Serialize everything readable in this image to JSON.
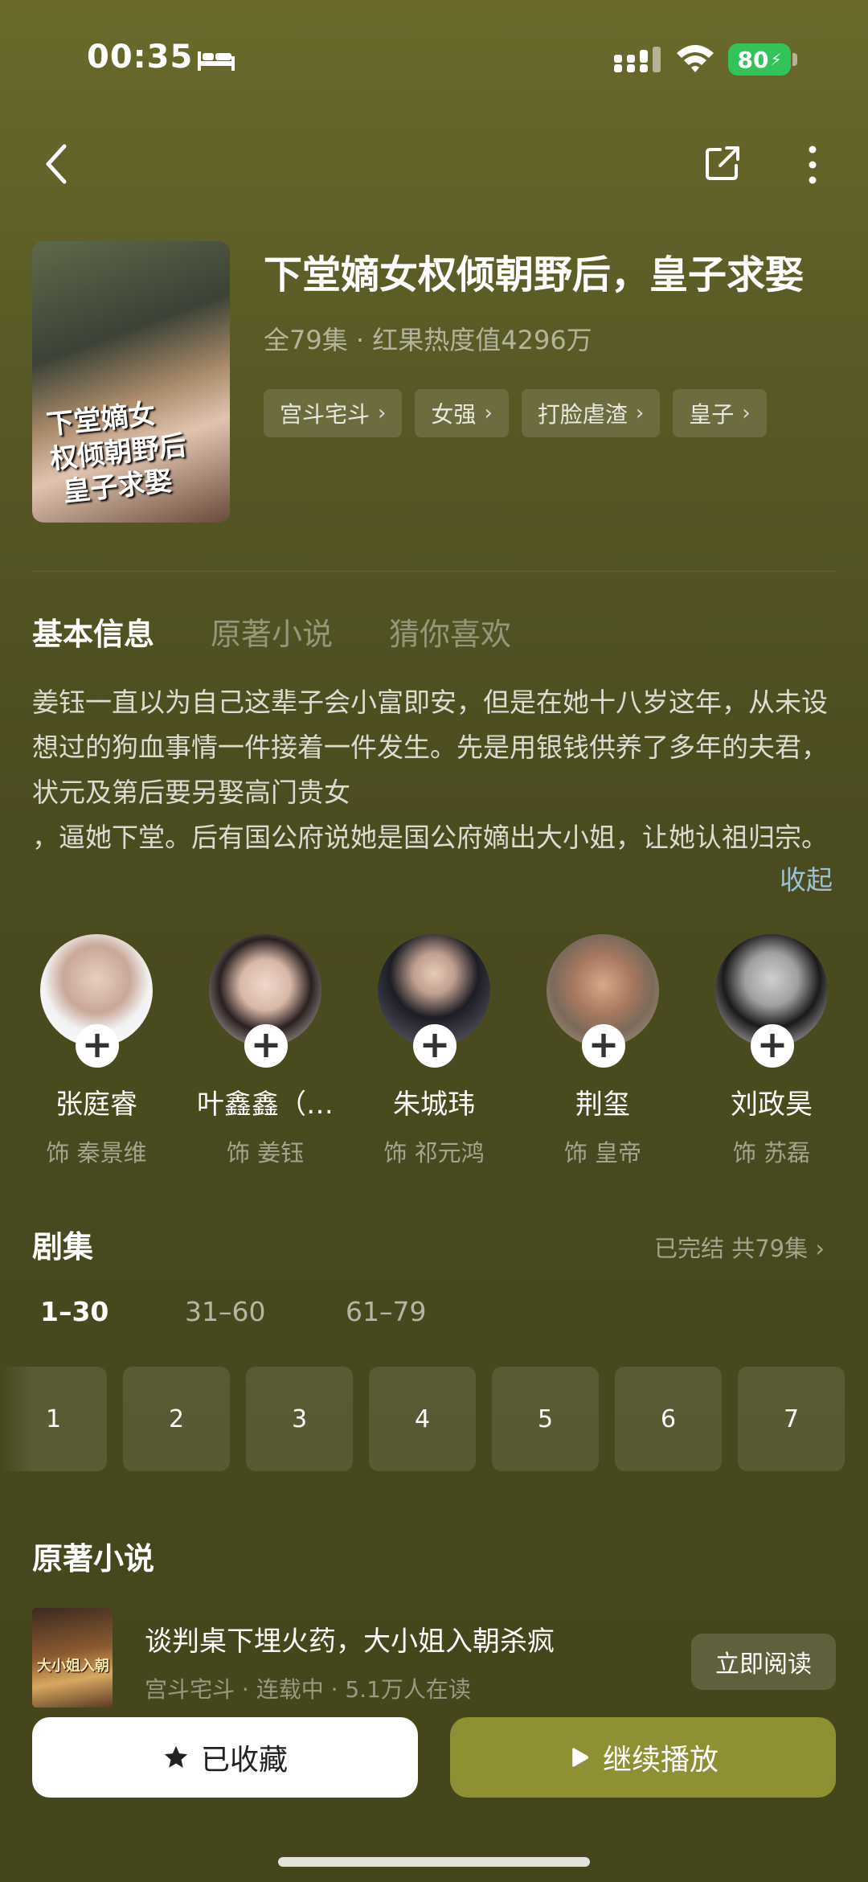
{
  "status_bar": {
    "time": "00:35",
    "battery": "80"
  },
  "show": {
    "title": "下堂嫡女权倾朝野后，皇子求娶",
    "meta": "全79集 · 红果热度值4296万",
    "poster_text": "下堂嫡女 权倾朝野后 皇子求娶",
    "tags": [
      "宫斗宅斗",
      "女强",
      "打脸虐渣",
      "皇子"
    ]
  },
  "tabs": [
    "基本信息",
    "原著小说",
    "猜你喜欢"
  ],
  "synopsis": "姜钰一直以为自己这辈子会小富即安，但是在她十八岁这年，从未设想过的狗血事情一件接着一件发生。先是用银钱供养了多年的夫君，状元及第后要另娶高门贵女\n，逼她下堂。后有国公府说她是国公府嫡出大小姐，让她认祖归宗。",
  "collapse_label": "收起",
  "cast": [
    {
      "name": "张庭睿",
      "role": "饰 秦景维"
    },
    {
      "name": "叶鑫鑫（…",
      "role": "饰 姜钰"
    },
    {
      "name": "朱城玮",
      "role": "饰 祁元鸿"
    },
    {
      "name": "荆玺",
      "role": "饰 皇帝"
    },
    {
      "name": "刘政昊",
      "role": "饰 苏磊"
    }
  ],
  "episodes": {
    "title": "剧集",
    "status": "已完结 共79集",
    "ranges": [
      "1–30",
      "31–60",
      "61–79"
    ],
    "visible": [
      "1",
      "2",
      "3",
      "4",
      "5",
      "6",
      "7"
    ]
  },
  "novel": {
    "section_title": "原著小说",
    "title": "谈判桌下埋火药，大小姐入朝杀疯",
    "meta": "宫斗宅斗 · 连载中 · 5.1万人在读",
    "read_label": "立即阅读",
    "cover_text": "大小姐入朝"
  },
  "actions": {
    "favorite": "已收藏",
    "play": "继续播放"
  },
  "colors": {
    "accent": "#8f8f33",
    "battery": "#32c45a",
    "link": "#9ec0d8"
  }
}
